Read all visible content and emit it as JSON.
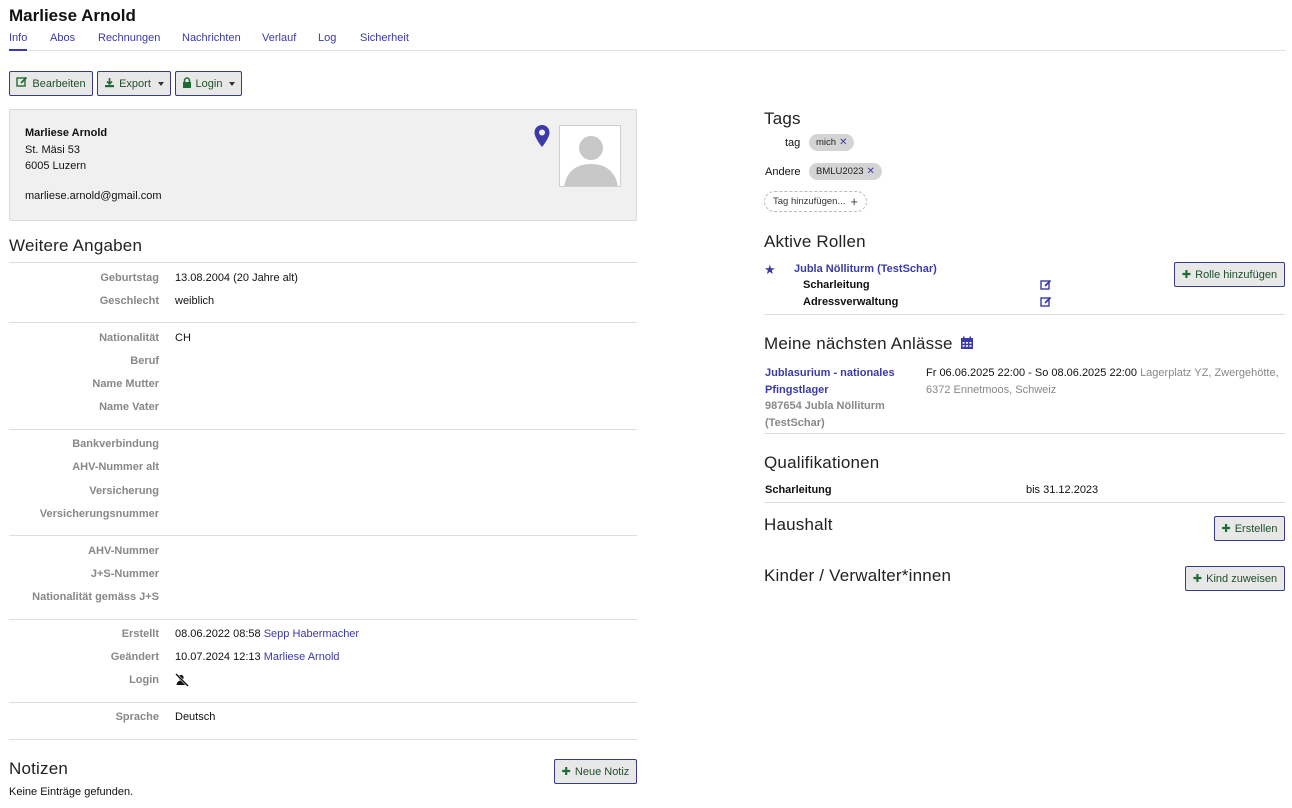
{
  "person": {
    "name": "Marliese Arnold",
    "street": "St. Mäsi 53",
    "city": "6005 Luzern",
    "email": "marliese.arnold@gmail.com"
  },
  "tabs": [
    "Info",
    "Abos",
    "Rechnungen",
    "Nachrichten",
    "Verlauf",
    "Log",
    "Sicherheit"
  ],
  "toolbar": {
    "edit_label": "Bearbeiten",
    "export_label": "Export",
    "login_label": "Login"
  },
  "details": {
    "heading": "Weitere Angaben",
    "birthday_label": "Geburtstag",
    "birthday_value": "13.08.2004 (20 Jahre alt)",
    "gender_label": "Geschlecht",
    "gender_value": "weiblich",
    "nationality_label": "Nationalität",
    "nationality_value": "CH",
    "job_label": "Beruf",
    "mother_label": "Name Mutter",
    "father_label": "Name Vater",
    "bank_label": "Bankverbindung",
    "ahv_old_label": "AHV-Nummer alt",
    "insurance_label": "Versicherung",
    "insurance_no_label": "Versicherungsnummer",
    "ahv_label": "AHV-Nummer",
    "js_label": "J+S-Nummer",
    "js_nationality_label": "Nationalität gemäss J+S",
    "created_label": "Erstellt",
    "created_value": "08.06.2022 08:58",
    "created_by": "Sepp Habermacher",
    "changed_label": "Geändert",
    "changed_value": "10.07.2024 12:13",
    "changed_by": "Marliese Arnold",
    "login_label": "Login",
    "language_label": "Sprache",
    "language_value": "Deutsch"
  },
  "notes": {
    "heading": "Notizen",
    "add_label": "Neue Notiz",
    "empty": "Keine Einträge gefunden."
  },
  "tags": {
    "heading": "Tags",
    "groups": [
      {
        "label": "tag",
        "value": "mich"
      },
      {
        "label": "Andere",
        "value": "BMLU2023"
      }
    ],
    "add_label": "Tag hinzufügen..."
  },
  "roles": {
    "heading": "Aktive Rollen",
    "group": "Jubla Nölliturm (TestSchar)",
    "items": [
      "Scharleitung",
      "Adressverwaltung"
    ],
    "add_label": "Rolle hinzufügen"
  },
  "events": {
    "heading": "Meine nächsten Anlässe",
    "name_line1": "Jublasurium - nationales",
    "name_line2": "Pfingstlager",
    "group_line1": "987654 Jubla Nölliturm",
    "group_line2": "(TestSchar)",
    "dates": "Fr 06.06.2025 22:00 - So 08.06.2025 22:00",
    "location_line1": "Lagerplatz YZ, Zwergehötte,",
    "location_line2": "6372 Ennetmoos, Schweiz"
  },
  "qualifications": {
    "heading": "Qualifikationen",
    "name": "Scharleitung",
    "valid": "bis 31.12.2023"
  },
  "household": {
    "heading": "Haushalt",
    "add_label": "Erstellen"
  },
  "children": {
    "heading": "Kinder / Verwalter*innen",
    "add_label": "Kind zuweisen"
  },
  "colors": {
    "link": "#3a3aa8",
    "button_icon": "#1f6b34",
    "card_bg": "#f0f0f0"
  }
}
